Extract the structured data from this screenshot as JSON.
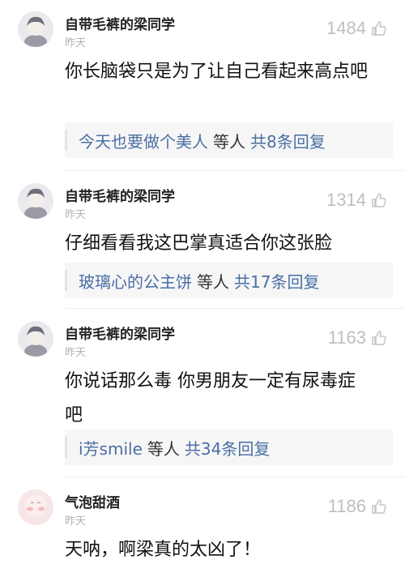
{
  "comments": [
    {
      "username": "自带毛裤的梁同学",
      "time": "昨天",
      "likes": "1484",
      "text": "你长脑袋只是为了让自己看起来高点吧",
      "reply_user": "今天也要做个美人",
      "reply_etc": "等人",
      "reply_count": "共8条回复"
    },
    {
      "username": "自带毛裤的梁同学",
      "time": "昨天",
      "likes": "1314",
      "text": "仔细看看我这巴掌真适合你这张脸",
      "reply_user": "玻璃心的公主饼",
      "reply_etc": "等人",
      "reply_count": "共17条回复"
    },
    {
      "username": "自带毛裤的梁同学",
      "time": "昨天",
      "likes": "1163",
      "text": "你说话那么毒 你男朋友一定有尿毒症吧",
      "reply_user": "i芳smile",
      "reply_etc": "等人",
      "reply_count": "共34条回复"
    },
    {
      "username": "气泡甜酒",
      "time": "昨天",
      "likes": "1186",
      "text": "天呐，啊梁真的太凶了！"
    }
  ],
  "icons": {
    "like": "thumbs-up-icon",
    "avatar_style_1": "anime-character",
    "avatar_style_2": "pink-blush"
  },
  "colors": {
    "link": "#4a6fa5",
    "muted": "#bfbfbf",
    "reply_bg": "#f6f6f6"
  }
}
